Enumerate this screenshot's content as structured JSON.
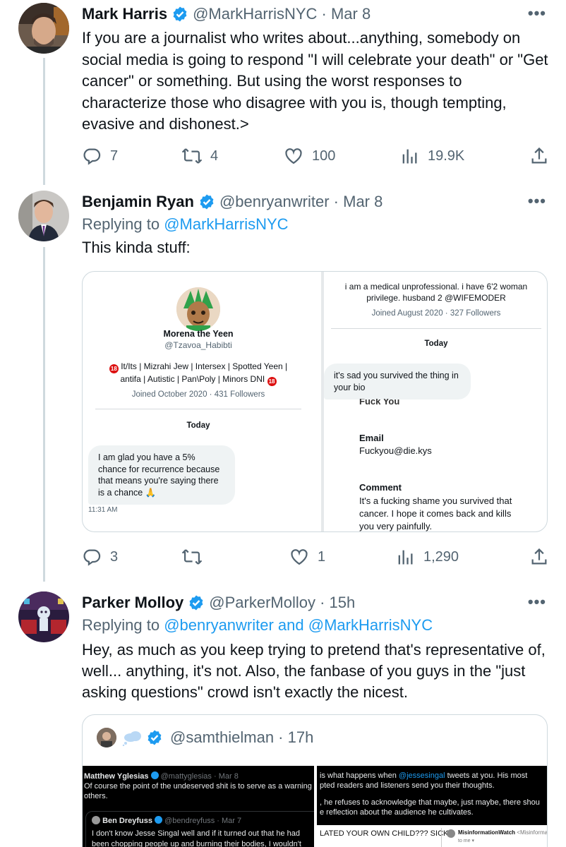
{
  "tweets": [
    {
      "name": "Mark Harris",
      "handle": "@MarkHarrisNYC",
      "date": "Mar 8",
      "text": "If you are a journalist who writes about...anything,   somebody on social media is going to respond \"I will celebrate your death\" or \"Get cancer\" or something. But using the worst responses to characterize those who disagree with you is, though tempting, evasive and dishonest.>",
      "stats": {
        "replies": "7",
        "retweets": "4",
        "likes": "100",
        "views": "19.9K"
      }
    },
    {
      "name": "Benjamin Ryan",
      "handle": "@benryanwriter",
      "date": "Mar 8",
      "replying_label": "Replying to",
      "replying_to": "@MarkHarrisNYC",
      "text": "This kinda stuff:",
      "stats": {
        "replies": "3",
        "retweets": "",
        "likes": "1",
        "views": "1,290"
      }
    },
    {
      "name": "Parker Molloy",
      "handle": "@ParkerMolloy",
      "date": "15h",
      "replying_label": "Replying to",
      "replying_to": "@benryanwriter and @MarkHarrisNYC",
      "text": "Hey, as much as you keep trying to pretend that's representative of, well... anything, it's not. Also, the fanbase of you guys in the \"just asking questions\" crowd isn't exactly the nicest."
    }
  ],
  "media": {
    "left": {
      "profile_name": "Morena the Yeen",
      "profile_handle": "@Tzavoa_Habibti",
      "bio_line1": "It/Its | Mizrahi Jew | Intersex | Spotted Yeen |",
      "bio_line2": "antifa | Autistic | Pan\\Poly | Minors DNI",
      "joined": "Joined October 2020 · 431 Followers",
      "day": "Today",
      "message": "I am glad you have a 5% chance for recurrence because that means you're saying there is a chance 🙏",
      "time": "11:31 AM"
    },
    "right": {
      "bio_line1": "i am a medical unprofessional. i have 6'2 woman",
      "bio_line2": "privilege. husband 2 @WIFEMODER",
      "joined": "Joined August 2020 · 327 Followers",
      "day": "Today",
      "message": "it's sad you survived the thing in your bio",
      "cut_text": "Fuck You",
      "email_label": "Email",
      "email_value": "Fuckyou@die.kys",
      "comment_label": "Comment",
      "comment_text": "It's a fucking shame you survived that cancer. I hope it comes back and kills you very painfully."
    }
  },
  "quote": {
    "handle": "@samthielman",
    "time": "17h",
    "panel1": {
      "name": "Matthew Yglesias",
      "handle": "@mattyglesias · Mar 8",
      "text": "Of course the point of the undeserved shit is to serve as a warning to others.",
      "inner_name": "Ben Dreyfuss",
      "inner_handle": "@bendreyfuss · Mar 7",
      "inner_text": "I don't know Jesse Singal well and if it turned out that he had been chopping people up and burning their bodies, I wouldn't have a"
    },
    "panel2": {
      "line1_a": "is what happens when ",
      "line1_link": "@jessesingal",
      "line1_b": " tweets at you. His most",
      "line2": "pted readers and listeners send you their thoughts.",
      "line3": ", he refuses to acknowledge that maybe, just maybe, there shou",
      "line4": "e reflection about the audience he cultivates.",
      "caps": "LATED YOUR OWN CHILD??? SICK",
      "sender": "MisinformationWatch",
      "sender_meta": "<MisinformationWatch@p",
      "to": "to me ▾"
    }
  },
  "colors": {
    "accent": "#1d9bf0",
    "muted": "#536471",
    "verified": "#1d9bf0"
  }
}
